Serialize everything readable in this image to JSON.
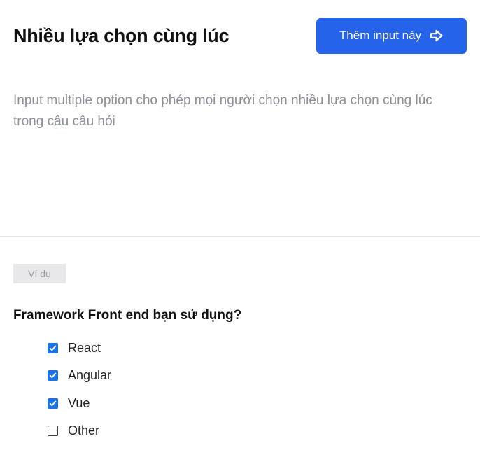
{
  "header": {
    "title": "Nhiều lựa chọn cùng lúc",
    "add_button_label": "Thêm input này",
    "add_button_icon": "arrow-right-icon",
    "accent_color": "#2563eb"
  },
  "description": "Input multiple option cho phép mọi người chọn nhiều lựa chọn cùng lúc trong câu câu hỏi",
  "example": {
    "badge_label": "Ví dụ",
    "question": "Framework Front end bạn sử dụng?",
    "options": [
      {
        "label": "React",
        "checked": true
      },
      {
        "label": "Angular",
        "checked": true
      },
      {
        "label": "Vue",
        "checked": true
      },
      {
        "label": "Other",
        "checked": false
      }
    ]
  }
}
